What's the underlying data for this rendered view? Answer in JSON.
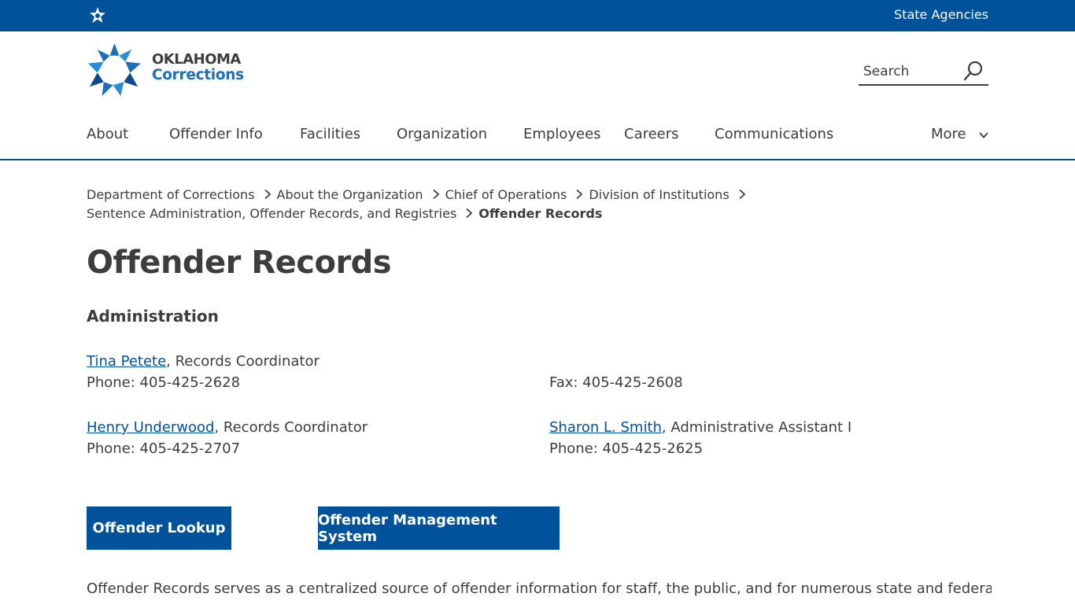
{
  "topbar": {
    "state_agencies_label": "State Agencies"
  },
  "logo": {
    "line1": "OKLAHOMA",
    "line2": "Corrections"
  },
  "search": {
    "placeholder": "Search",
    "value": ""
  },
  "nav": {
    "items": [
      {
        "label": "About"
      },
      {
        "label": "Offender Info"
      },
      {
        "label": "Facilities"
      },
      {
        "label": "Organization"
      },
      {
        "label": "Employees"
      },
      {
        "label": "Careers"
      },
      {
        "label": "Communications"
      }
    ],
    "more_label": "More"
  },
  "breadcrumb": {
    "items": [
      "Department of Corrections",
      "About the Organization",
      "Chief of Operations",
      "Division of Institutions",
      "Sentence Administration, Offender Records, and Registries"
    ],
    "current": "Offender Records"
  },
  "page": {
    "title": "Offender Records",
    "section_title": "Administration"
  },
  "contacts": [
    {
      "name": "Tina Petete",
      "role": ", Records Coordinator",
      "phone": "Phone: 405-425-2628"
    },
    {
      "fax": "Fax: 405-425-2608"
    },
    {
      "name": "Henry Underwood",
      "role": ", Records Coordinator",
      "phone": "Phone: 405-425-2707"
    },
    {
      "name": "Sharon L. Smith",
      "role": ", Administrative Assistant I",
      "phone": "Phone: 405-425-2625"
    }
  ],
  "buttons": {
    "lookup": "Offender Lookup",
    "oms": "Offender Management System"
  },
  "intro_text": "Offender Records serves as a centralized source of offender information for staff, the public, and for numerous state and federal",
  "colors": {
    "brand_blue": "#00529b",
    "logo_blue": "#1f6fb5",
    "text": "#3d3d3d"
  },
  "icons": {
    "topbar": "oklahoma-star-icon",
    "logo": "corrections-star-icon",
    "search": "search-icon",
    "separator": "chevron-right-icon",
    "more": "chevron-down-icon"
  }
}
